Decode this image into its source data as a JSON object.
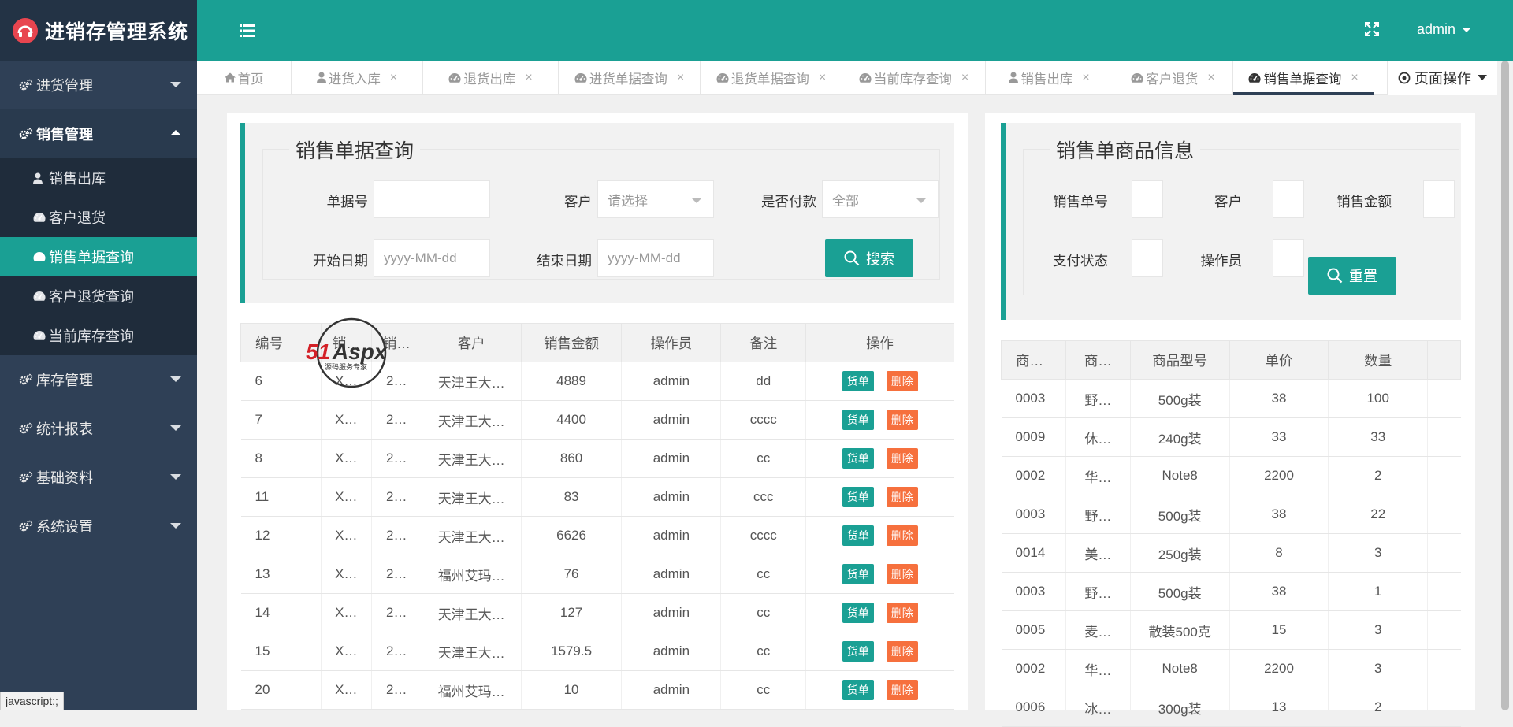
{
  "app_title": "进销存管理系统",
  "sidebar": {
    "menus": [
      {
        "label": "进货管理",
        "open": false
      },
      {
        "label": "销售管理",
        "open": true
      },
      {
        "label": "库存管理",
        "open": false
      },
      {
        "label": "统计报表",
        "open": false
      },
      {
        "label": "基础资料",
        "open": false
      },
      {
        "label": "系统设置",
        "open": false
      }
    ],
    "sales_sub": [
      {
        "label": "销售出库",
        "icon": "user-icon"
      },
      {
        "label": "客户退货",
        "icon": "dashboard-icon"
      },
      {
        "label": "销售单据查询",
        "icon": "dashboard-icon",
        "active": true
      },
      {
        "label": "客户退货查询",
        "icon": "dashboard-icon"
      },
      {
        "label": "当前库存查询",
        "icon": "dashboard-icon"
      }
    ]
  },
  "status_tip": "javascript:;",
  "header": {
    "user": "admin"
  },
  "tabs": [
    {
      "label": "首页",
      "icon": "home-icon"
    },
    {
      "label": "进货入库",
      "icon": "user-icon"
    },
    {
      "label": "退货出库",
      "icon": "dashboard-icon"
    },
    {
      "label": "进货单据查询",
      "icon": "dashboard-icon"
    },
    {
      "label": "退货单据查询",
      "icon": "dashboard-icon"
    },
    {
      "label": "当前库存查询",
      "icon": "dashboard-icon"
    },
    {
      "label": "销售出库",
      "icon": "user-icon"
    },
    {
      "label": "客户退货",
      "icon": "dashboard-icon"
    },
    {
      "label": "销售单据查询",
      "icon": "dashboard-icon",
      "active": true
    }
  ],
  "page_op": "页面操作",
  "search_form": {
    "title": "销售单据查询",
    "order_no_label": "单据号",
    "customer_label": "客户",
    "customer_placeholder": "请选择",
    "paid_label": "是否付款",
    "paid_value": "全部",
    "start_label": "开始日期",
    "start_placeholder": "yyyy-MM-dd",
    "end_label": "结束日期",
    "end_placeholder": "yyyy-MM-dd",
    "search_btn": "搜索"
  },
  "orders_table": {
    "headers": [
      "编号",
      "销…",
      "销…",
      "客户",
      "销售金额",
      "操作员",
      "备注",
      "操作"
    ],
    "btn_detail": "货单",
    "btn_delete": "删除",
    "rows": [
      [
        "6",
        "X…",
        "2…",
        "天津王大…",
        "4889",
        "admin",
        "dd"
      ],
      [
        "7",
        "X…",
        "2…",
        "天津王大…",
        "4400",
        "admin",
        "cccc"
      ],
      [
        "8",
        "X…",
        "2…",
        "天津王大…",
        "860",
        "admin",
        "cc"
      ],
      [
        "11",
        "X…",
        "2…",
        "天津王大…",
        "83",
        "admin",
        "ccc"
      ],
      [
        "12",
        "X…",
        "2…",
        "天津王大…",
        "6626",
        "admin",
        "cccc"
      ],
      [
        "13",
        "X…",
        "2…",
        "福州艾玛…",
        "76",
        "admin",
        "cc"
      ],
      [
        "14",
        "X…",
        "2…",
        "天津王大…",
        "127",
        "admin",
        "cc"
      ],
      [
        "15",
        "X…",
        "2…",
        "天津王大…",
        "1579.5",
        "admin",
        "cc"
      ],
      [
        "20",
        "X…",
        "2…",
        "福州艾玛…",
        "10",
        "admin",
        "cc"
      ]
    ]
  },
  "detail_form": {
    "title": "销售单商品信息",
    "order_no_label": "销售单号",
    "customer_label": "客户",
    "amount_label": "销售金额",
    "pay_status_label": "支付状态",
    "operator_label": "操作员",
    "reset_btn": "重置"
  },
  "items_table": {
    "headers": [
      "商…",
      "商…",
      "商品型号",
      "单价",
      "数量"
    ],
    "rows": [
      [
        "0003",
        "野…",
        "500g装",
        "38",
        "100"
      ],
      [
        "0009",
        "休…",
        "240g装",
        "33",
        "33"
      ],
      [
        "0002",
        "华…",
        "Note8",
        "2200",
        "2"
      ],
      [
        "0003",
        "野…",
        "500g装",
        "38",
        "22"
      ],
      [
        "0014",
        "美…",
        "250g装",
        "8",
        "3"
      ],
      [
        "0003",
        "野…",
        "500g装",
        "38",
        "1"
      ],
      [
        "0005",
        "麦…",
        "散装500克",
        "15",
        "3"
      ],
      [
        "0002",
        "华…",
        "Note8",
        "2200",
        "3"
      ],
      [
        "0006",
        "冰…",
        "300g装",
        "13",
        "2"
      ]
    ]
  },
  "watermark": {
    "brand": "51Aspx",
    "tagline": "源码服务专家"
  },
  "colors": {
    "primary": "#1aa094",
    "sidebar": "#2f4056",
    "danger": "#f6703d"
  }
}
